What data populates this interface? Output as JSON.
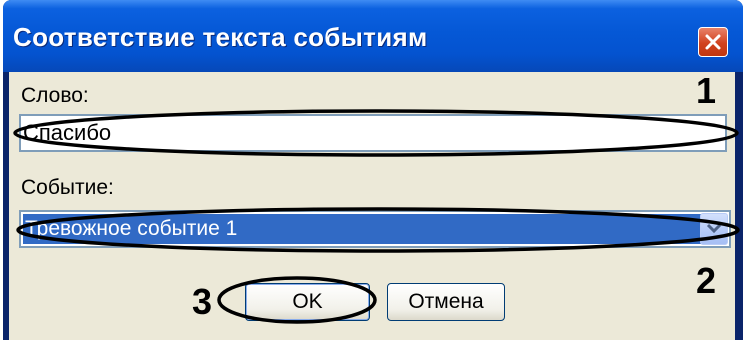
{
  "dialog": {
    "title": "Соответствие текста событиям",
    "close_icon": "close-icon"
  },
  "form": {
    "word_label": "Слово:",
    "word_value": "Спасибо",
    "event_label": "Событие:",
    "event_value": "Тревожное событие 1",
    "dropdown_icon": "chevron-down-icon"
  },
  "buttons": {
    "ok": "OK",
    "cancel": "Отмена"
  },
  "annotations": {
    "n1": "1",
    "n2": "2",
    "n3": "3"
  },
  "colors": {
    "title_bar": "#0558d6",
    "client_bg": "#ece9d8",
    "selection": "#316ac5",
    "close_button": "#d1421e",
    "annotation": "#000000"
  }
}
